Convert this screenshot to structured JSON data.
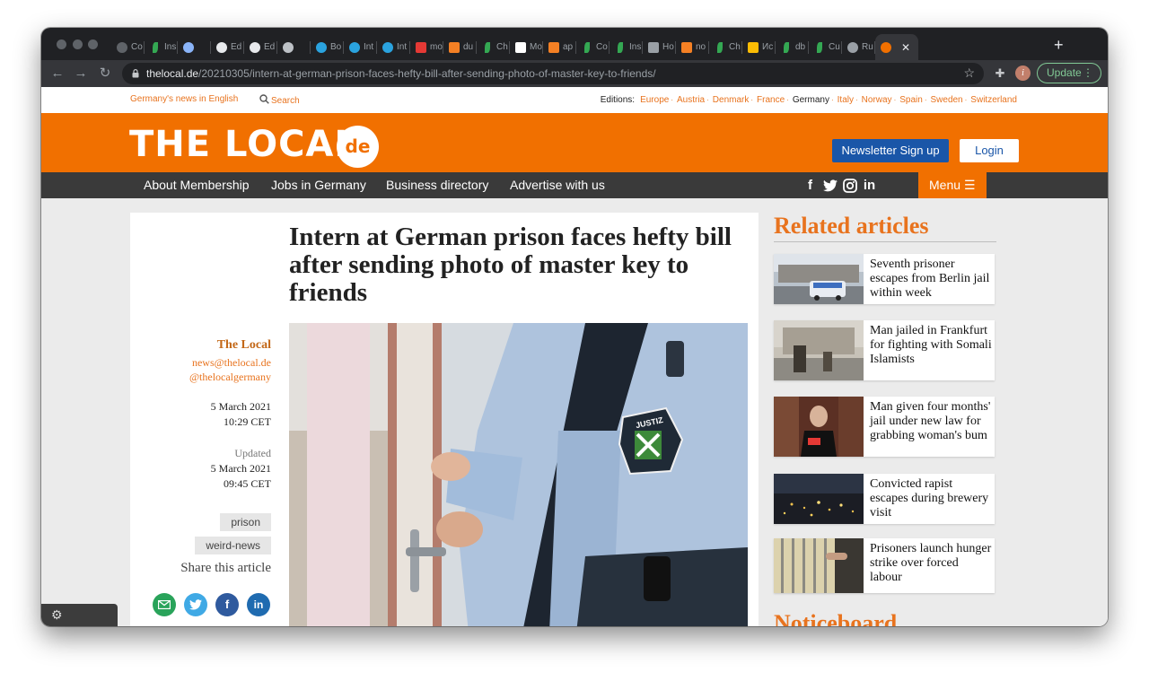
{
  "browser": {
    "tabs": [
      {
        "label": "Co",
        "icon": "generic-globe-icon",
        "color": "#5f6368"
      },
      {
        "label": "Ins",
        "icon": "leaf-icon",
        "color": "#34a853"
      },
      {
        "label": "",
        "icon": "circle-icon",
        "color": "#8ab4f8"
      },
      {
        "label": "Ed",
        "icon": "github-icon",
        "color": "#e8eaed"
      },
      {
        "label": "Ed",
        "icon": "github-icon",
        "color": "#e8eaed"
      },
      {
        "label": "",
        "icon": "circle-icon",
        "color": "#bdc1c6"
      },
      {
        "label": "Bo",
        "icon": "telegram-icon",
        "color": "#2aa3df"
      },
      {
        "label": "Int",
        "icon": "telegram-icon",
        "color": "#2aa3df"
      },
      {
        "label": "Int",
        "icon": "telegram-icon",
        "color": "#2aa3df"
      },
      {
        "label": "mo",
        "icon": "bookmark-icon",
        "color": "#e53935"
      },
      {
        "label": "du",
        "icon": "stack-icon",
        "color": "#f48024"
      },
      {
        "label": "Ch",
        "icon": "leaf-icon",
        "color": "#34a853"
      },
      {
        "label": "Mo",
        "icon": "medium-icon",
        "color": "#ffffff"
      },
      {
        "label": "ap",
        "icon": "stack-icon",
        "color": "#f48024"
      },
      {
        "label": "Co",
        "icon": "leaf-icon",
        "color": "#34a853"
      },
      {
        "label": "Ins",
        "icon": "leaf-icon",
        "color": "#34a853"
      },
      {
        "label": "Ho",
        "icon": "heart-icon",
        "color": "#9aa0a6"
      },
      {
        "label": "no",
        "icon": "stack-icon",
        "color": "#f48024"
      },
      {
        "label": "Ch",
        "icon": "leaf-icon",
        "color": "#34a853"
      },
      {
        "label": "Ис",
        "icon": "star-icon",
        "color": "#fbbc04"
      },
      {
        "label": "db",
        "icon": "leaf-icon",
        "color": "#34a853"
      },
      {
        "label": "Cu",
        "icon": "leaf-icon",
        "color": "#34a853"
      },
      {
        "label": "Ru",
        "icon": "circle-icon",
        "color": "#9aa0a6"
      }
    ],
    "active_tab": {
      "icon": "thelocal-de-icon",
      "color": "#f17000",
      "close": "✕"
    },
    "new_tab": "+",
    "url_host": "thelocal.de",
    "url_path": "/20210305/intern-at-german-prison-faces-hefty-bill-after-sending-photo-of-master-key-to-friends/",
    "update_label": "Update",
    "profile_initial": "i"
  },
  "topbar": {
    "tagline": "Germany's news in English",
    "search": "Search",
    "editions_label": "Editions:",
    "editions": [
      {
        "name": "Europe",
        "current": false
      },
      {
        "name": "Austria",
        "current": false
      },
      {
        "name": "Denmark",
        "current": false
      },
      {
        "name": "France",
        "current": false
      },
      {
        "name": "Germany",
        "current": true
      },
      {
        "name": "Italy",
        "current": false
      },
      {
        "name": "Norway",
        "current": false
      },
      {
        "name": "Spain",
        "current": false
      },
      {
        "name": "Sweden",
        "current": false
      },
      {
        "name": "Switzerland",
        "current": false
      }
    ]
  },
  "header": {
    "logo_text": "THE LOCAL",
    "logo_badge": "de",
    "newsletter": "Newsletter Sign up",
    "login": "Login",
    "brand_color": "#f17000"
  },
  "nav": {
    "links": [
      "About Membership",
      "Jobs in Germany",
      "Business directory",
      "Advertise with us"
    ],
    "social": [
      "facebook-icon",
      "twitter-icon",
      "instagram-icon",
      "linkedin-icon"
    ],
    "menu": "Menu"
  },
  "article": {
    "headline": "Intern at German prison faces hefty bill after sending photo of master key to friends",
    "author": "The Local",
    "author_email": "news@thelocal.de",
    "author_twitter": "@thelocalgermany",
    "published_date": "5 March 2021",
    "published_time": "10:29 CET",
    "updated_label": "Updated",
    "updated_date": "5 March 2021",
    "updated_time": "09:45 CET",
    "tags": [
      "prison",
      "weird-news"
    ],
    "share_label": "Share this article",
    "share_icons": [
      "email-icon",
      "twitter-icon",
      "facebook-icon",
      "linkedin-icon"
    ],
    "photo_badge": "JUSTIZ"
  },
  "sidebar": {
    "related_title": "Related articles",
    "related": [
      {
        "title": "Seventh prisoner escapes from Berlin jail within week"
      },
      {
        "title": "Man jailed in Frankfurt for fighting with Somali Islamists"
      },
      {
        "title": "Man given four months' jail under new law for grabbing woman's bum"
      },
      {
        "title": "Convicted rapist escapes during brewery visit"
      },
      {
        "title": "Prisoners launch hunger strike over forced labour"
      }
    ],
    "noticeboard_title": "Noticeboard"
  }
}
